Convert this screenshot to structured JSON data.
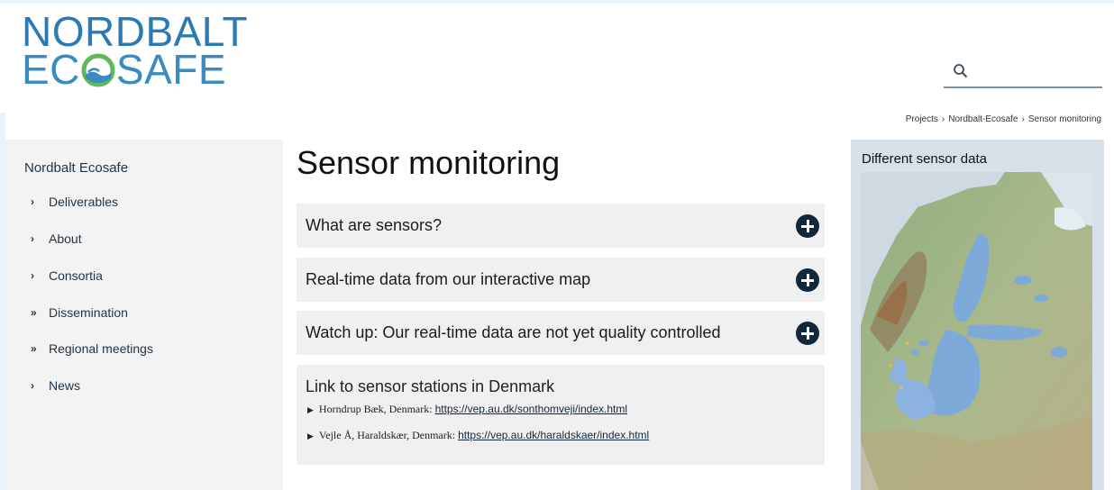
{
  "logo": {
    "line1": "NORDBALT",
    "line2_pre": "EC",
    "line2_post": "SAFE"
  },
  "search": {
    "placeholder": ""
  },
  "breadcrumb": {
    "items": [
      "Projects",
      "Nordbalt-Ecosafe",
      "Sensor monitoring"
    ],
    "separator": "›"
  },
  "sidebar": {
    "title": "Nordbalt Ecosafe",
    "items": [
      {
        "chevron": "›",
        "label": "Deliverables"
      },
      {
        "chevron": "»",
        "label": "About"
      },
      {
        "chevron": "›",
        "label": "Consortia"
      },
      {
        "chevron": "»",
        "label": "Dissemination"
      },
      {
        "chevron": "»",
        "label": "Regional meetings"
      },
      {
        "chevron": "›",
        "label": "News"
      }
    ]
  },
  "main": {
    "title": "Sensor monitoring",
    "accordion": [
      {
        "label": "What are sensors?"
      },
      {
        "label": "Real-time data from our interactive map"
      },
      {
        "label": "Watch up: Our real-time data are not yet quality controlled"
      }
    ],
    "links_box": {
      "title": "Link to sensor stations in Denmark",
      "links": [
        {
          "text": "Horndrup Bæk, Denmark: ",
          "url_text": "https://vep.au.dk/sonthomveji/index.html"
        },
        {
          "text": "Vejle Å, Haraldskær, Denmark: ",
          "url_text": "https://vep.au.dk/haraldskaer/index.html"
        }
      ]
    }
  },
  "right_panel": {
    "title": "Different sensor data"
  },
  "colors": {
    "brand_blue": "#2b7ab3",
    "navy": "#13273a",
    "panel_grey": "#f0f0f0",
    "right_panel_bg": "#d8e1ea"
  },
  "icons": {
    "search": "search-icon",
    "expand": "plus-circle-icon",
    "globe": "globe-icon"
  }
}
